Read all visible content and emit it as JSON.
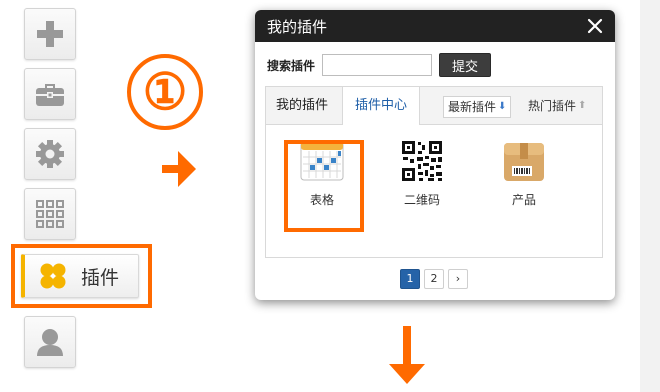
{
  "toolbar": {
    "buttons": [
      {
        "icon": "plus-icon"
      },
      {
        "icon": "briefcase-icon"
      },
      {
        "icon": "gear-icon"
      },
      {
        "icon": "grid-icon"
      },
      {
        "icon": "clover-icon",
        "label": "插件"
      },
      {
        "icon": "user-icon"
      }
    ]
  },
  "annotation": {
    "step_number": "①",
    "accent_color": "#ff6a00"
  },
  "dialog": {
    "title": "我的插件",
    "search": {
      "label": "搜索插件",
      "value": "",
      "submit_label": "提交"
    },
    "tabs": [
      {
        "label": "我的插件",
        "active": false
      },
      {
        "label": "插件中心",
        "active": true
      }
    ],
    "sort": [
      {
        "label": "最新插件",
        "direction": "down"
      },
      {
        "label": "热门插件",
        "direction": "up"
      }
    ],
    "plugins": [
      {
        "label": "表格",
        "icon": "table-calendar-icon",
        "highlighted": true
      },
      {
        "label": "二维码",
        "icon": "qr-code-icon",
        "highlighted": false
      },
      {
        "label": "产品",
        "icon": "box-icon",
        "highlighted": false
      }
    ],
    "pagination": {
      "pages": [
        "1",
        "2"
      ],
      "current": "1",
      "next": "›"
    }
  }
}
